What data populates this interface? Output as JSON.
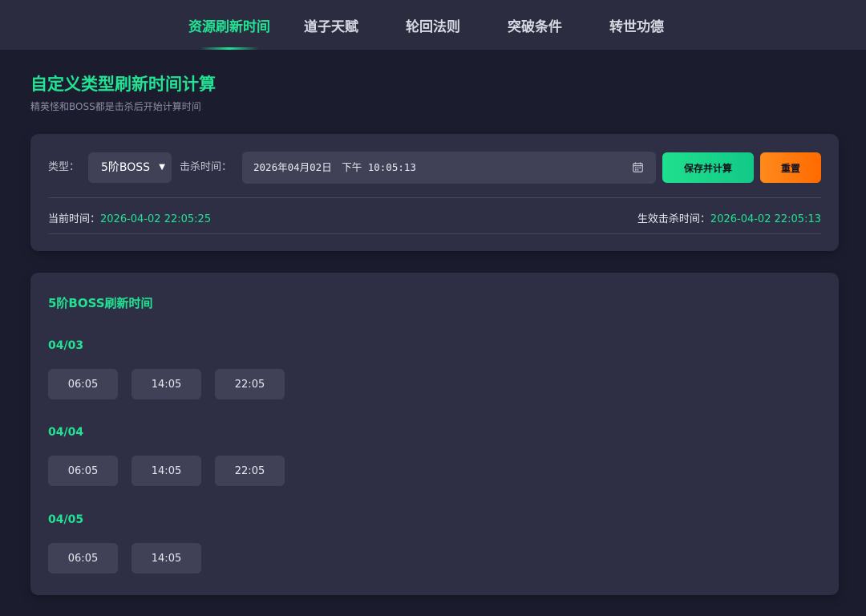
{
  "nav": {
    "tabs": [
      {
        "label": "资源刷新时间",
        "active": true
      },
      {
        "label": "道子天赋"
      },
      {
        "label": "轮回法则"
      },
      {
        "label": "突破条件"
      },
      {
        "label": "转世功德"
      }
    ]
  },
  "page": {
    "title": "自定义类型刷新时间计算",
    "subtitle": "精英怪和BOSS都是击杀后开始计算时间"
  },
  "form": {
    "type_label": "类型：",
    "type_value": "5阶BOSS",
    "kill_time_label": "击杀时间：",
    "kill_time_value": "2026年04月02日　下午 10:05:13",
    "save_button": "保存并计算",
    "reset_button": "重置",
    "current_time_label": "当前时间：",
    "current_time_value": "2026-04-02 22:05:25",
    "effective_kill_label": "生效击杀时间：",
    "effective_kill_value": "2026-04-02 22:05:13"
  },
  "results": {
    "title": "5阶BOSS刷新时间",
    "days": [
      {
        "date": "04/03",
        "times": [
          "06:05",
          "14:05",
          "22:05"
        ]
      },
      {
        "date": "04/04",
        "times": [
          "06:05",
          "14:05",
          "22:05"
        ]
      },
      {
        "date": "04/05",
        "times": [
          "06:05",
          "14:05"
        ]
      }
    ]
  },
  "colors": {
    "accent": "#22e394",
    "reset": "#ff7a0e",
    "background": "#1b1c2e",
    "card": "#2e2f45"
  }
}
